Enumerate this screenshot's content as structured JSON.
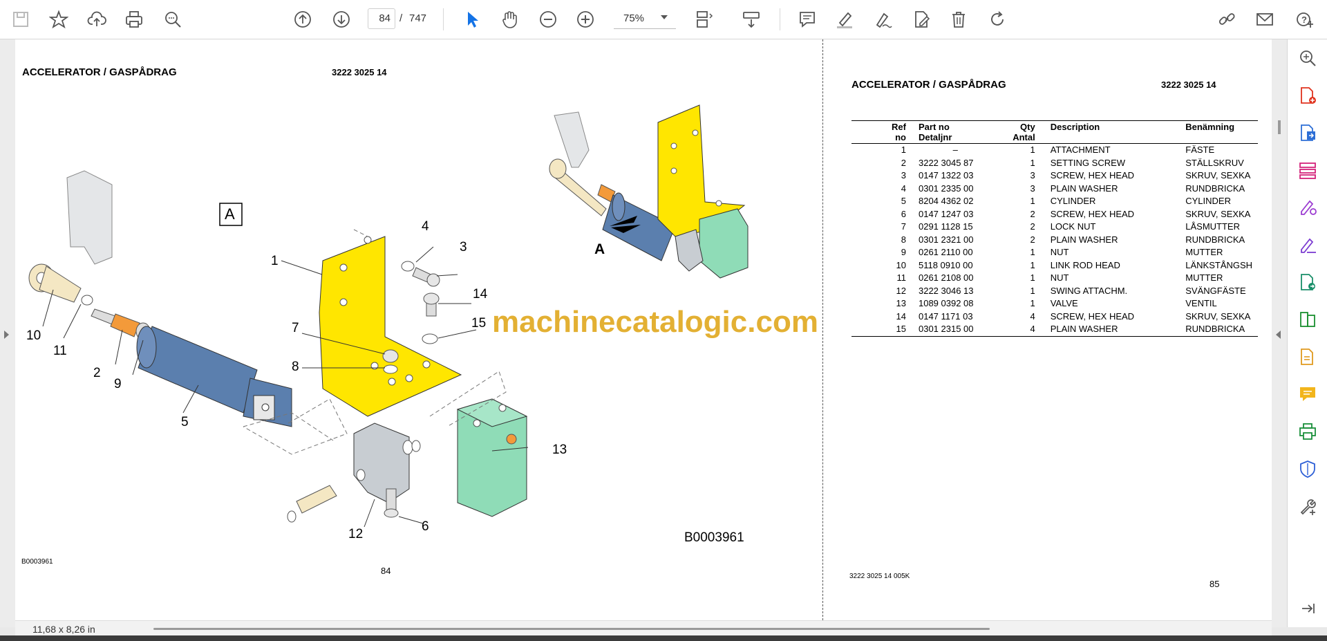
{
  "toolbar": {
    "page_current": "84",
    "page_separator": "/",
    "page_total": "747",
    "zoom": "75%",
    "icons_left": [
      "save-icon",
      "bookmark-star-icon",
      "upload-cloud-icon",
      "print-icon",
      "find-zoom-icon"
    ],
    "icons_nav": [
      "previous-page-icon",
      "next-page-icon"
    ],
    "icons_view": [
      "select-cursor-icon",
      "hand-pan-icon",
      "zoom-out-icon",
      "zoom-in-icon"
    ],
    "icons_right": [
      "comment-icon",
      "highlight-icon",
      "sign-icon",
      "edit-pdf-icon",
      "delete-icon",
      "rotate-icon"
    ],
    "icons_far_right": [
      "share-link-icon",
      "email-icon",
      "help-user-icon"
    ]
  },
  "right_panel": {
    "icons": [
      "zoom-search-icon",
      "create-pdf-icon",
      "export-pdf-icon",
      "organize-pages-icon",
      "fill-sign-icon",
      "edit-sign-icon",
      "send-for-review-icon",
      "compare-icon",
      "export-doc-icon",
      "comment-panel-icon",
      "print-production-icon",
      "protect-icon",
      "more-tools-icon",
      "collapse-panel-icon"
    ]
  },
  "left_page": {
    "title": "ACCELERATOR / GASPÅDRAG",
    "part_number": "3222 3025 14",
    "figure_code_small": "B0003961",
    "figure_code_large": "B0003961",
    "page_number": "84",
    "view_label": "A",
    "callouts": [
      "1",
      "2",
      "3",
      "4",
      "5",
      "6",
      "7",
      "8",
      "9",
      "10",
      "11",
      "12",
      "13",
      "14",
      "15"
    ]
  },
  "inset": {
    "label": "A"
  },
  "right_page": {
    "title": "ACCELERATOR / GASPÅDRAG",
    "part_number": "3222 3025 14",
    "columns": {
      "ref": "Ref",
      "ref2": "no",
      "part": "Part no",
      "part2": "Detaljnr",
      "qty": "Qty",
      "qty2": "Antal",
      "desc": "Description",
      "sv": "Benämning"
    },
    "rows": [
      {
        "ref": "1",
        "part": "–",
        "qty": "1",
        "desc": "ATTACHMENT",
        "sv": "FÄSTE"
      },
      {
        "ref": "2",
        "part": "3222 3045 87",
        "qty": "1",
        "desc": "SETTING SCREW",
        "sv": "STÄLLSKRUV"
      },
      {
        "ref": "3",
        "part": "0147 1322 03",
        "qty": "3",
        "desc": "SCREW, HEX HEAD",
        "sv": "SKRUV, SEXKA"
      },
      {
        "ref": "4",
        "part": "0301 2335 00",
        "qty": "3",
        "desc": "PLAIN WASHER",
        "sv": "RUNDBRICKA"
      },
      {
        "ref": "5",
        "part": "8204 4362 02",
        "qty": "1",
        "desc": "CYLINDER",
        "sv": "CYLINDER"
      },
      {
        "ref": "6",
        "part": "0147 1247 03",
        "qty": "2",
        "desc": "SCREW, HEX HEAD",
        "sv": "SKRUV, SEXKA"
      },
      {
        "ref": "7",
        "part": "0291 1128 15",
        "qty": "2",
        "desc": "LOCK NUT",
        "sv": "LÅSMUTTER"
      },
      {
        "ref": "8",
        "part": "0301 2321 00",
        "qty": "2",
        "desc": "PLAIN WASHER",
        "sv": "RUNDBRICKA"
      },
      {
        "ref": "9",
        "part": "0261 2110 00",
        "qty": "1",
        "desc": "NUT",
        "sv": "MUTTER"
      },
      {
        "ref": "10",
        "part": "5118 0910 00",
        "qty": "1",
        "desc": "LINK ROD HEAD",
        "sv": "LÄNKSTÅNGSH"
      },
      {
        "ref": "11",
        "part": "0261 2108 00",
        "qty": "1",
        "desc": "NUT",
        "sv": "MUTTER"
      },
      {
        "ref": "12",
        "part": "3222 3046 13",
        "qty": "1",
        "desc": "SWING ATTACHM.",
        "sv": "SVÄNGFÄSTE"
      },
      {
        "ref": "13",
        "part": "1089 0392 08",
        "qty": "1",
        "desc": "VALVE",
        "sv": "VENTIL"
      },
      {
        "ref": "14",
        "part": "0147 1171 03",
        "qty": "4",
        "desc": "SCREW, HEX HEAD",
        "sv": "SKRUV, SEXKA"
      },
      {
        "ref": "15",
        "part": "0301 2315 00",
        "qty": "4",
        "desc": "PLAIN WASHER",
        "sv": "RUNDBRICKA"
      }
    ],
    "footer_code": "3222 3025 14  005K",
    "page_number": "85"
  },
  "watermark": "machinecatalogic.com",
  "status": {
    "page_size": "11,68 x 8,26 in"
  },
  "colors": {
    "bracket_yellow": "#ffe600",
    "cylinder_blue": "#5b7fae",
    "valve_green": "#8fdcb7",
    "orange_nut": "#f39a3a",
    "swing_grey": "#c8cdd2",
    "accent_blue": "#1473e6",
    "watermark_gold": "#e0a81e"
  }
}
